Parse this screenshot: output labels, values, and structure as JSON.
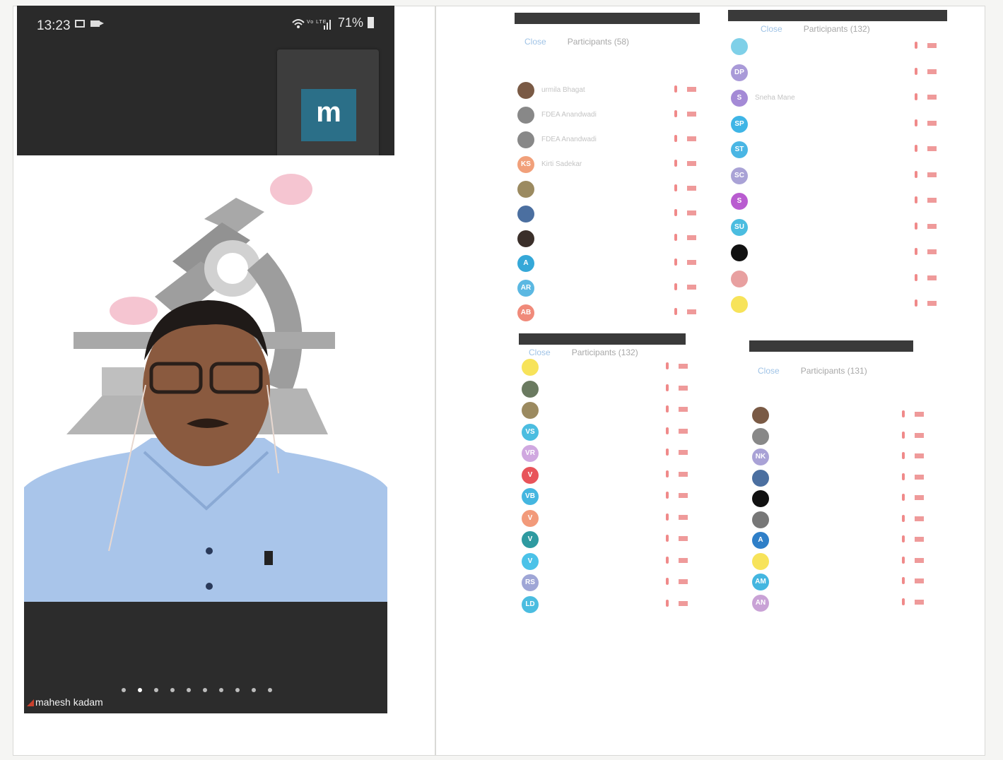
{
  "phone": {
    "time": "13:23",
    "signal_text": "Vo LTE",
    "battery": "71%",
    "self_avatar_letter": "m",
    "speaker_name": "mahesh kadam",
    "page_dot_count": 10,
    "active_dot_index": 1
  },
  "lists": [
    {
      "close": "Close",
      "title": "Participants (58)",
      "rows": [
        {
          "name": "urmila Bhagat",
          "avatar": "photo",
          "color": "#7a5a45"
        },
        {
          "name": "FDEA Anandwadi",
          "avatar": "logo",
          "color": "#888888"
        },
        {
          "name": "FDEA Anandwadi",
          "avatar": "logo",
          "color": "#888888"
        },
        {
          "name": "Kirti Sadekar",
          "avatar": "KS",
          "color": "#f1a07a"
        },
        {
          "name": "",
          "avatar": "photo",
          "color": "#9b8a60"
        },
        {
          "name": "",
          "avatar": "photo",
          "color": "#4b6fa0"
        },
        {
          "name": "",
          "avatar": "photo",
          "color": "#3a2f2a"
        },
        {
          "name": "",
          "avatar": "A",
          "color": "#35a8d8"
        },
        {
          "name": "",
          "avatar": "AR",
          "color": "#5bb8e2"
        },
        {
          "name": "",
          "avatar": "AB",
          "color": "#f08a7a"
        }
      ]
    },
    {
      "close": "Close",
      "title": "Participants (132)",
      "rows": [
        {
          "name": "",
          "avatar": "",
          "color": "#7fd0e8"
        },
        {
          "name": "",
          "avatar": "DP",
          "color": "#a99ad8"
        },
        {
          "name": "Sneha Mane",
          "avatar": "S",
          "color": "#a48ad6"
        },
        {
          "name": "",
          "avatar": "SP",
          "color": "#3fb5e6"
        },
        {
          "name": "",
          "avatar": "ST",
          "color": "#4ab6e4"
        },
        {
          "name": "",
          "avatar": "SC",
          "color": "#a9a2d6"
        },
        {
          "name": "",
          "avatar": "S",
          "color": "#b95cd0"
        },
        {
          "name": "",
          "avatar": "SU",
          "color": "#4bbde0"
        },
        {
          "name": "",
          "avatar": "photo",
          "color": "#111111"
        },
        {
          "name": "",
          "avatar": "photo",
          "color": "#e8a0a0"
        },
        {
          "name": "",
          "avatar": "",
          "color": "#f7e35a"
        }
      ]
    },
    {
      "close": "Close",
      "title": "Participants (132)",
      "rows": [
        {
          "name": "",
          "avatar": "",
          "color": "#f7e35a"
        },
        {
          "name": "",
          "avatar": "photo",
          "color": "#6a7a60"
        },
        {
          "name": "",
          "avatar": "photo",
          "color": "#9b8a60"
        },
        {
          "name": "",
          "avatar": "VS",
          "color": "#4bbde0"
        },
        {
          "name": "",
          "avatar": "VR",
          "color": "#d0a8e0"
        },
        {
          "name": "",
          "avatar": "V",
          "color": "#e8545a"
        },
        {
          "name": "",
          "avatar": "VB",
          "color": "#44b6e0"
        },
        {
          "name": "",
          "avatar": "V",
          "color": "#f29a7a"
        },
        {
          "name": "",
          "avatar": "V",
          "color": "#2e9aa0"
        },
        {
          "name": "",
          "avatar": "V",
          "color": "#4bc2e8"
        },
        {
          "name": "",
          "avatar": "RS",
          "color": "#9fa6d6"
        },
        {
          "name": "",
          "avatar": "LD",
          "color": "#4bbde0"
        }
      ]
    },
    {
      "close": "Close",
      "title": "Participants (131)",
      "rows": [
        {
          "name": "",
          "avatar": "photo",
          "color": "#7a5a45"
        },
        {
          "name": "",
          "avatar": "logo",
          "color": "#888888"
        },
        {
          "name": "",
          "avatar": "NK",
          "color": "#a9a2d6"
        },
        {
          "name": "",
          "avatar": "photo",
          "color": "#4b6fa0"
        },
        {
          "name": "",
          "avatar": "photo",
          "color": "#111111"
        },
        {
          "name": "",
          "avatar": "photo",
          "color": "#777777"
        },
        {
          "name": "",
          "avatar": "A",
          "color": "#2f7fc8"
        },
        {
          "name": "",
          "avatar": "",
          "color": "#f7e35a"
        },
        {
          "name": "",
          "avatar": "AM",
          "color": "#44b6e0"
        },
        {
          "name": "",
          "avatar": "AN",
          "color": "#c9a2d6"
        }
      ]
    }
  ]
}
